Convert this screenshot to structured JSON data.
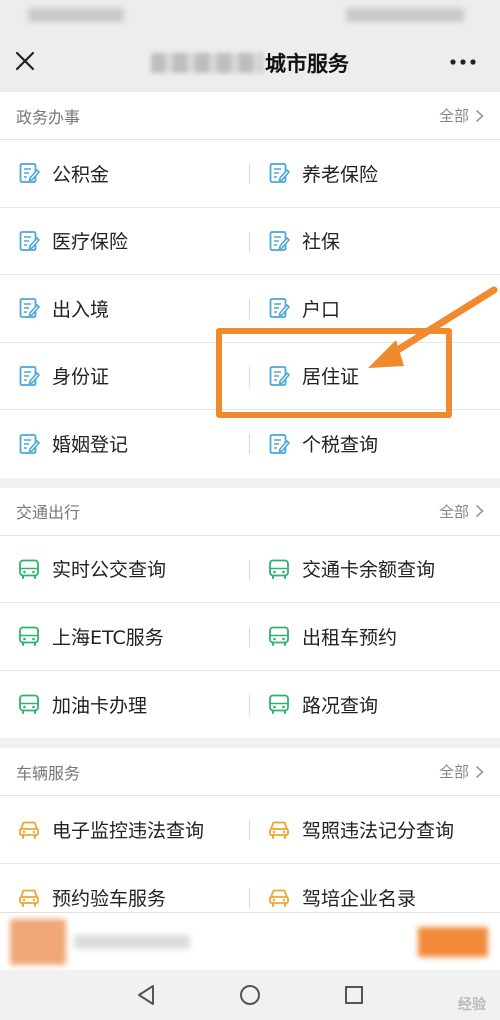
{
  "header": {
    "title_suffix": "城市服务"
  },
  "sections": [
    {
      "title": "政务办事",
      "all_label": "全部",
      "rows": [
        [
          "公积金",
          "养老保险"
        ],
        [
          "医疗保险",
          "社保"
        ],
        [
          "出入境",
          "户口"
        ],
        [
          "身份证",
          "居住证"
        ],
        [
          "婚姻登记",
          "个税查询"
        ]
      ]
    },
    {
      "title": "交通出行",
      "all_label": "全部",
      "rows": [
        [
          "实时公交查询",
          "交通卡余额查询"
        ],
        [
          "上海ETC服务",
          "出租车预约"
        ],
        [
          "加油卡办理",
          "路况查询"
        ]
      ]
    },
    {
      "title": "车辆服务",
      "all_label": "全部",
      "rows": [
        [
          "电子监控违法查询",
          "驾照违法记分查询"
        ],
        [
          "预约验车服务",
          "驾培企业名录"
        ]
      ]
    }
  ],
  "colors": {
    "doc_icon": "#4aa8d8",
    "bus_icon": "#2fb36b",
    "car_icon": "#f0a531",
    "highlight": "#f08a2c"
  },
  "icons": {
    "section_0": "document-edit-icon",
    "section_1": "bus-icon",
    "section_2": "car-icon"
  },
  "watermark": "经验"
}
